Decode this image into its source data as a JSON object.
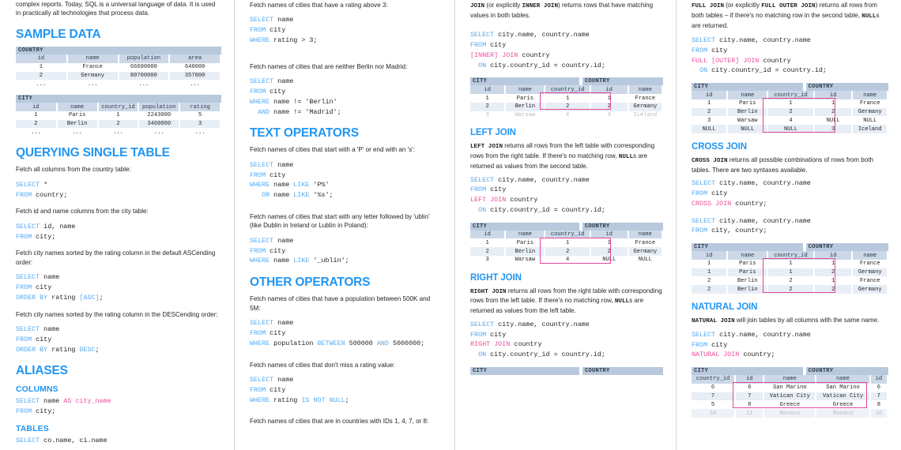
{
  "colors": {
    "accent_blue": "#2196f3",
    "code_keyword": "#56a9f0",
    "code_pink": "#ec4e9c",
    "table_header": "#ccd8e8",
    "table_title_bar": "#b9c9dd",
    "highlight_box": "#e24a96"
  },
  "column1": {
    "intro": "complex reports. Today, SQL is a universal language of data. It is used in practically all technologies that process data.",
    "sample_data": {
      "heading": "SAMPLE DATA",
      "country_table": {
        "title": "COUNTRY",
        "columns": [
          "id",
          "name",
          "population",
          "area"
        ],
        "rows": [
          [
            "1",
            "France",
            "66600000",
            "640000"
          ],
          [
            "2",
            "Germany",
            "80700000",
            "357000"
          ],
          [
            "...",
            "...",
            "...",
            "..."
          ]
        ]
      },
      "city_table": {
        "title": "CITY",
        "columns": [
          "id",
          "name",
          "country_id",
          "population",
          "rating"
        ],
        "rows": [
          [
            "1",
            "Paris",
            "1",
            "2243000",
            "5"
          ],
          [
            "2",
            "Berlin",
            "2",
            "3460000",
            "3"
          ],
          [
            "...",
            "...",
            "...",
            "...",
            "..."
          ]
        ]
      }
    },
    "querying": {
      "heading": "QUERYING SINGLE TABLE",
      "items": [
        {
          "desc": "Fetch all columns from the country table:",
          "code": "SELECT *\nFROM country;"
        },
        {
          "desc": "Fetch id and name columns from the city table:",
          "code": "SELECT id, name\nFROM city;"
        },
        {
          "desc": "Fetch city names sorted by the rating column in the default ASCending order:",
          "code": "SELECT name\nFROM city\nORDER BY rating [ASC];"
        },
        {
          "desc": "Fetch city names sorted by the rating column in the DESCending order:",
          "code": "SELECT name\nFROM city\nORDER BY rating DESC;"
        }
      ]
    },
    "aliases": {
      "heading": "ALIASES",
      "columns_sub": "COLUMNS",
      "columns_code": "SELECT name AS city_name\nFROM city;",
      "tables_sub": "TABLES",
      "tables_code": "SELECT co.name, ci.name"
    }
  },
  "column2": {
    "items_top": [
      {
        "desc": "Fetch names of cities that have a rating above 3:",
        "code": "SELECT name\nFROM city\nWHERE rating > 3;"
      },
      {
        "desc": "Fetch names of cities that are neither Berlin nor Madrid:",
        "code": "SELECT name\nFROM city\nWHERE name != 'Berlin'\n  AND name != 'Madrid';"
      }
    ],
    "text_operators": {
      "heading": "TEXT OPERATORS",
      "items": [
        {
          "desc": "Fetch names of cities that start with a 'P' or end with an 's':",
          "code": "SELECT name\nFROM city\nWHERE name LIKE 'P%'\n   OR name LIKE '%s';"
        },
        {
          "desc": "Fetch names of cities that start with any letter followed by 'ublin' (like Dublin in Ireland or Lublin in Poland):",
          "code": "SELECT name\nFROM city\nWHERE name LIKE '_ublin';"
        }
      ]
    },
    "other_operators": {
      "heading": "OTHER OPERATORS",
      "items": [
        {
          "desc": "Fetch names of cities that have a population between 500K and 5M:",
          "code": "SELECT name\nFROM city\nWHERE population BETWEEN 500000 AND 5000000;"
        },
        {
          "desc": "Fetch names of cities that don't miss a rating value:",
          "code": "SELECT name\nFROM city\nWHERE rating IS NOT NULL;"
        }
      ],
      "trailing_desc": "Fetch names of cities that are in countries with IDs 1, 4, 7, or 8:"
    }
  },
  "column3": {
    "inner_join": {
      "desc_parts": [
        "JOIN",
        " (or explicitly ",
        "INNER JOIN",
        ") returns rows that have matching values in both tables."
      ],
      "code": "SELECT city.name, country.name\nFROM city\n[INNER] JOIN country\n  ON city.country_id = country.id;",
      "left_title": "CITY",
      "right_title": "COUNTRY",
      "columns": [
        "id",
        "name",
        "country_id",
        "id",
        "name"
      ],
      "rows": [
        {
          "cells": [
            "1",
            "Paris",
            "1",
            "1",
            "France"
          ],
          "muted": false
        },
        {
          "cells": [
            "2",
            "Berlin",
            "2",
            "2",
            "Germany"
          ],
          "muted": false
        },
        {
          "cells": [
            "3",
            "Warsaw",
            "4",
            "3",
            "Iceland"
          ],
          "muted": true
        }
      ]
    },
    "left_join": {
      "heading": "LEFT JOIN",
      "desc_parts": [
        "LEFT JOIN",
        " returns all rows from the left table with corresponding rows from the right table. If there's no matching row, ",
        "NULL",
        "s are returned as values from the second table."
      ],
      "code": "SELECT city.name, country.name\nFROM city\nLEFT JOIN country\n  ON city.country_id = country.id;",
      "left_title": "CITY",
      "right_title": "COUNTRY",
      "columns": [
        "id",
        "name",
        "country_id",
        "id",
        "name"
      ],
      "rows": [
        {
          "cells": [
            "1",
            "Paris",
            "1",
            "1",
            "France"
          ],
          "muted": false
        },
        {
          "cells": [
            "2",
            "Berlin",
            "2",
            "2",
            "Germany"
          ],
          "muted": false
        },
        {
          "cells": [
            "3",
            "Warsaw",
            "4",
            "NULL",
            "NULL"
          ],
          "muted": false
        }
      ]
    },
    "right_join": {
      "heading": "RIGHT JOIN",
      "desc_parts": [
        "RIGHT JOIN",
        " returns all rows from the right table with corresponding rows from the left table. If there's no matching row, ",
        "NULL",
        "s are returned as values from the left table."
      ],
      "code": "SELECT city.name, country.name\nFROM city\nRIGHT JOIN country\n  ON city.country_id = country.id;",
      "left_title": "CITY",
      "right_title": "COUNTRY"
    }
  },
  "column4": {
    "full_join": {
      "desc_parts": [
        "FULL JOIN",
        " (or explicitly ",
        "FULL OUTER JOIN",
        ") returns all rows from both tables – if there's no matching row in the second table, ",
        "NULL",
        "s are returned."
      ],
      "code": "SELECT city.name, country.name\nFROM city\nFULL [OUTER] JOIN country\n  ON city.country_id = country.id;",
      "left_title": "CITY",
      "right_title": "COUNTRY",
      "columns": [
        "id",
        "name",
        "country_id",
        "id",
        "name"
      ],
      "rows": [
        {
          "cells": [
            "1",
            "Paris",
            "1",
            "1",
            "France"
          ],
          "muted": false
        },
        {
          "cells": [
            "2",
            "Berlin",
            "2",
            "2",
            "Germany"
          ],
          "muted": false
        },
        {
          "cells": [
            "3",
            "Warsaw",
            "4",
            "NULL",
            "NULL"
          ],
          "muted": false
        },
        {
          "cells": [
            "NULL",
            "NULL",
            "NULL",
            "3",
            "Iceland"
          ],
          "muted": false
        }
      ]
    },
    "cross_join": {
      "heading": "CROSS JOIN",
      "desc_parts": [
        "CROSS JOIN",
        " returns all possible combinations of rows from both tables. There are two syntaxes available."
      ],
      "code1": "SELECT city.name, country.name\nFROM city\nCROSS JOIN country;",
      "code2": "SELECT city.name, country.name\nFROM city, country;",
      "left_title": "CITY",
      "right_title": "COUNTRY",
      "columns": [
        "id",
        "name",
        "country_id",
        "id",
        "name"
      ],
      "rows": [
        {
          "cells": [
            "1",
            "Paris",
            "1",
            "1",
            "France"
          ],
          "muted": false
        },
        {
          "cells": [
            "1",
            "Paris",
            "1",
            "2",
            "Germany"
          ],
          "muted": false
        },
        {
          "cells": [
            "2",
            "Berlin",
            "2",
            "1",
            "France"
          ],
          "muted": false
        },
        {
          "cells": [
            "2",
            "Berlin",
            "2",
            "2",
            "Germany"
          ],
          "muted": false
        }
      ]
    },
    "natural_join": {
      "heading": "NATURAL JOIN",
      "desc_parts": [
        "NATURAL JOIN",
        " will join tables by all columns with the same name."
      ],
      "code": "SELECT city.name, country.name\nFROM city\nNATURAL JOIN country;",
      "left_title": "CITY",
      "right_title": "COUNTRY",
      "columns": [
        "country_id",
        "id",
        "name",
        "name",
        "id"
      ],
      "rows": [
        {
          "cells": [
            "6",
            "6",
            "San Marino",
            "San Marino",
            "6"
          ],
          "muted": false
        },
        {
          "cells": [
            "7",
            "7",
            "Vatican City",
            "Vatican City",
            "7"
          ],
          "muted": false
        },
        {
          "cells": [
            "5",
            "8",
            "Greece",
            "Greece",
            "8"
          ],
          "muted": false
        },
        {
          "cells": [
            "10",
            "11",
            "Monaco",
            "Monaco",
            "10"
          ],
          "muted": true
        }
      ]
    }
  }
}
